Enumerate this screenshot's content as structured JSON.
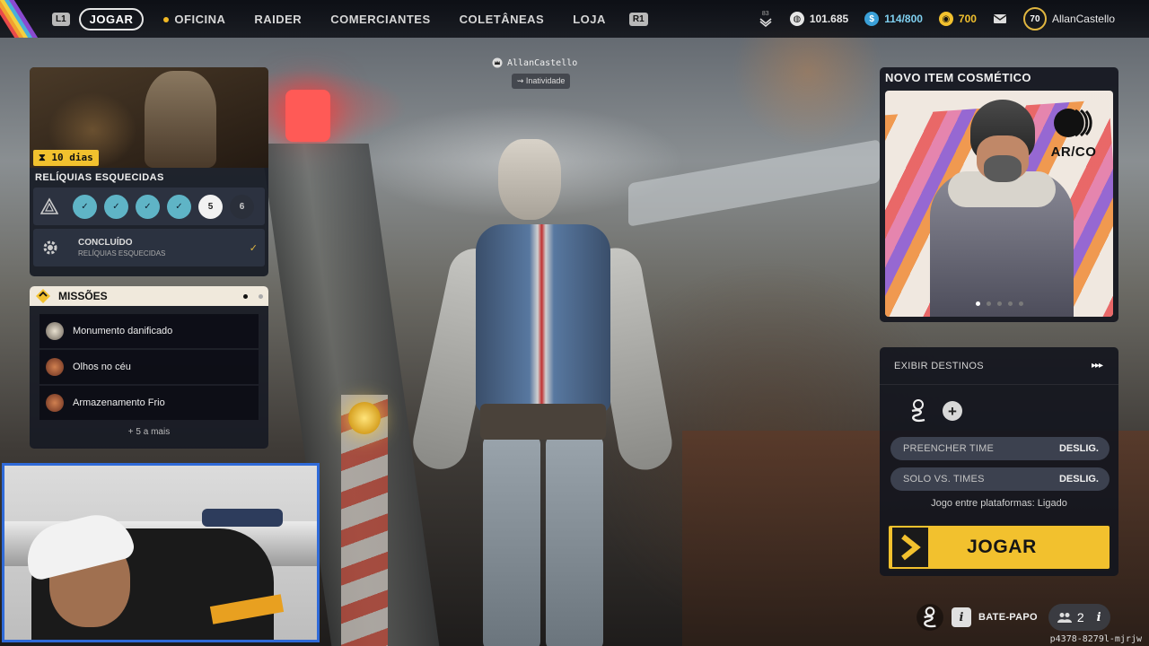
{
  "topbar": {
    "key_left": "L1",
    "key_right": "R1",
    "nav": [
      {
        "label": "JOGAR",
        "active": true
      },
      {
        "label": "OFICINA",
        "active": false
      },
      {
        "label": "RAIDER",
        "active": false
      },
      {
        "label": "COMERCIANTES",
        "active": false
      },
      {
        "label": "COLETÂNEAS",
        "active": false
      },
      {
        "label": "LOJA",
        "active": false
      }
    ],
    "rank": "83",
    "currency_coins": "101.685",
    "currency_capacity": "114/800",
    "currency_premium": "700",
    "level": "70",
    "username": "AllanCastello"
  },
  "player_tag": {
    "name": "AllanCastello",
    "status": "Inatividade"
  },
  "event": {
    "timer": "10 dias",
    "title": "RELÍQUIAS ESQUECIDAS",
    "steps": [
      {
        "label": "✓",
        "state": "done"
      },
      {
        "label": "✓",
        "state": "done"
      },
      {
        "label": "✓",
        "state": "done"
      },
      {
        "label": "✓",
        "state": "done"
      },
      {
        "label": "5",
        "state": "current"
      },
      {
        "label": "6",
        "state": "todo"
      }
    ],
    "completed_title": "CONCLUÍDO",
    "completed_sub": "RELÍQUIAS ESQUECIDAS"
  },
  "missions": {
    "title": "MISSÕES",
    "items": [
      {
        "label": "Monumento danificado"
      },
      {
        "label": "Olhos no céu"
      },
      {
        "label": "Armazenamento Frio"
      }
    ],
    "more": "+ 5 a mais"
  },
  "cosmetic": {
    "title": "NOVO ITEM COSMÉTICO",
    "brand": "AR/CO",
    "dots": 5,
    "active_dot": 0
  },
  "launch": {
    "destinations": "EXIBIR DESTINOS",
    "fill_team_label": "PREENCHER TIME",
    "fill_team_value": "DESLIG.",
    "solo_label": "SOLO VS. TIMES",
    "solo_value": "DESLIG.",
    "crossplay": "Jogo entre plataformas: Ligado",
    "play": "JOGAR"
  },
  "bottom": {
    "chat": "BATE-PAPO",
    "friends": "2",
    "session_code": "p4378-8279l-mjrjw"
  },
  "colors": {
    "accent": "#f2c12e",
    "step_done": "#5fb4c6",
    "webcam_border": "#2f6ad8"
  }
}
